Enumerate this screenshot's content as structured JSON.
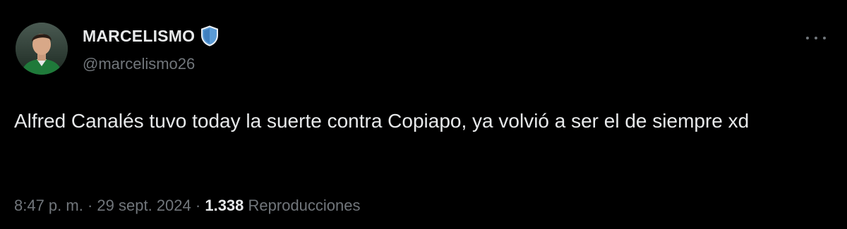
{
  "author": {
    "display_name": "MARCELISMO",
    "handle": "@marcelismo26",
    "badge_icon": "shield-badge-icon",
    "badge_color": "#5b9bd5"
  },
  "menu": {
    "icon": "more-options-icon"
  },
  "post": {
    "text": "Alfred Canalés tuvo today la suerte contra Copiapo, ya volvió a ser el de siempre xd"
  },
  "meta": {
    "time": "8:47 p. m.",
    "separator": "·",
    "date": "29 sept. 2024",
    "views_count": "1.338",
    "views_label": "Reproducciones"
  },
  "colors": {
    "background": "#000000",
    "primary_text": "#e7e9ea",
    "secondary_text": "#71767b"
  }
}
